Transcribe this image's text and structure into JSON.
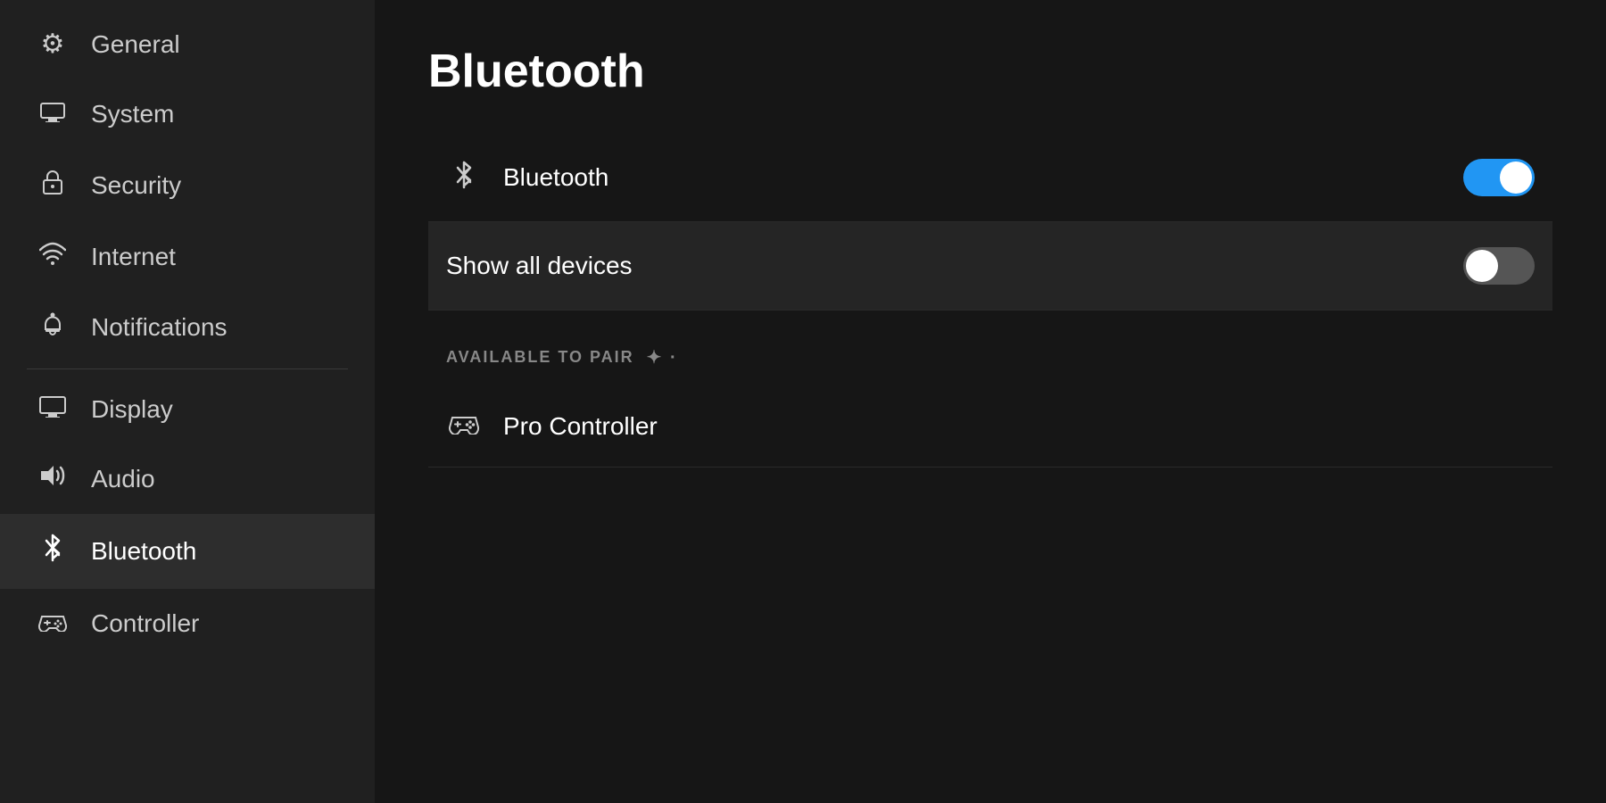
{
  "sidebar": {
    "items": [
      {
        "id": "general",
        "label": "General",
        "icon": "⚙",
        "active": false
      },
      {
        "id": "system",
        "label": "System",
        "icon": "🖥",
        "active": false
      },
      {
        "id": "security",
        "label": "Security",
        "icon": "🔒",
        "active": false
      },
      {
        "id": "internet",
        "label": "Internet",
        "icon": "📶",
        "active": false
      },
      {
        "id": "notifications",
        "label": "Notifications",
        "icon": "ℹ",
        "active": false
      },
      {
        "id": "display",
        "label": "Display",
        "icon": "🖥",
        "active": false
      },
      {
        "id": "audio",
        "label": "Audio",
        "icon": "🔊",
        "active": false
      },
      {
        "id": "bluetooth",
        "label": "Bluetooth",
        "icon": "✦",
        "active": true
      },
      {
        "id": "controller",
        "label": "Controller",
        "icon": "🎮",
        "active": false
      }
    ]
  },
  "main": {
    "title": "Bluetooth",
    "bluetooth_row": {
      "label": "Bluetooth",
      "toggle": true
    },
    "show_all_devices_row": {
      "label": "Show all devices",
      "toggle": false
    },
    "available_to_pair_label": "AVAILABLE TO PAIR",
    "devices": [
      {
        "id": "pro-controller",
        "name": "Pro Controller"
      }
    ]
  }
}
